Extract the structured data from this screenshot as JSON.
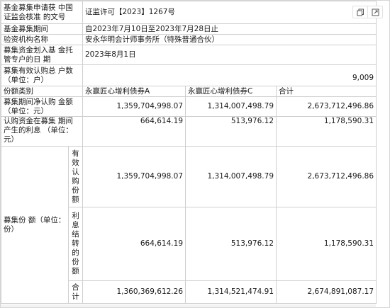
{
  "rows": {
    "approval_label": "基金募集申请获 中国证监会核准 的文号",
    "approval_value": "证监许可【2023】1267号",
    "period_label": "基金募集期间",
    "period_value": "自2023年7月10日至2023年7月28日止",
    "auditor_label": "验资机构名称",
    "auditor_value": "安永华明会计师事务所（特殊普通合伙）",
    "transfer_label": "募集资金划入基 金托管专户的日 期",
    "transfer_value": "2023年8月1日",
    "households_label": "募集有效认购总 户数（单位：户）",
    "households_value": "9,009",
    "share_class_label": "份额类别",
    "class_a": "永赢匠心增利债券A",
    "class_c": "永赢匠心增利债券C",
    "total": "合计",
    "net_amount_label": "募集期间净认购 金额（单位：元）",
    "net_a": "1,359,704,998.07",
    "net_c": "1,314,007,498.79",
    "net_total": "2,673,712,496.86",
    "interest_label": "认购资金在募集 期间产生的利息 （单位：元）",
    "interest_a": "664,614.19",
    "interest_c": "513,976.12",
    "interest_total": "1,178,590.31",
    "shares_label": "募集份 额（单位：份）",
    "valid_sub_label": "有效认购份额",
    "valid_a": "1,359,704,998.07",
    "valid_c": "1,314,007,498.79",
    "valid_total": "2,673,712,496.86",
    "interest_conv_label": "利息结转的份额",
    "conv_a": "664,614.19",
    "conv_c": "513,976.12",
    "conv_total": "1,178,590.31",
    "sum_label": "合计",
    "sum_a": "1,360,369,612.26",
    "sum_c": "1,314,521,474.91",
    "sum_total": "2,674,891,087.17"
  },
  "toolbar": {
    "icons": [
      "copy-icon",
      "export-icon"
    ]
  }
}
